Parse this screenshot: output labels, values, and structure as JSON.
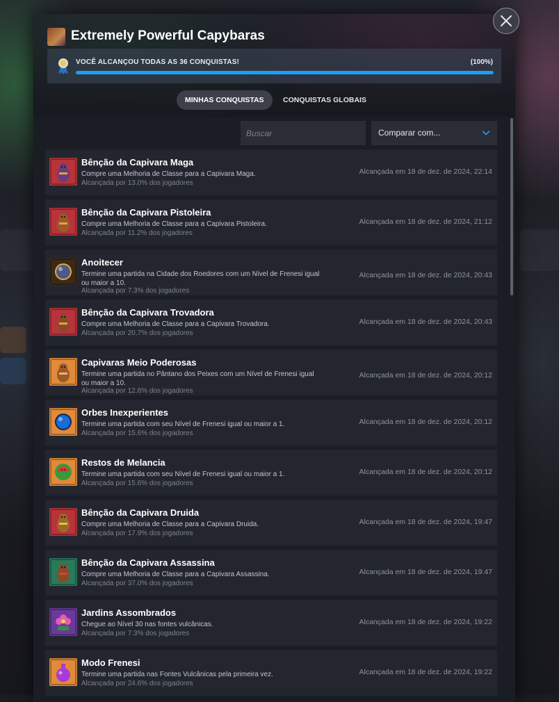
{
  "game": {
    "title": "Extremely Powerful Capybaras"
  },
  "progress": {
    "label": "VOCÊ ALCANÇOU TODAS AS 36 CONQUISTAS!",
    "percent_label": "(100%)",
    "fraction": 1.0,
    "color": "#1a9fff"
  },
  "tabs": [
    {
      "label": "MINHAS CONQUISTAS",
      "active": true
    },
    {
      "label": "CONQUISTAS GLOBAIS",
      "active": false
    }
  ],
  "search": {
    "placeholder": "Buscar"
  },
  "compare": {
    "label": "Comparar com..."
  },
  "achievements": [
    {
      "title": "Bênção da Capivara Maga",
      "desc": "Compre uma Melhoria de Classe para a Capivara Maga.",
      "pct": "Alcançada por 13.0% dos jogadores",
      "date": "Alcançada em 18 de dez. de 2024, 22:14",
      "icon": "mage-capybara-icon"
    },
    {
      "title": "Bênção da Capivara Pistoleira",
      "desc": "Compre uma Melhoria de Classe para a Capivara Pistoleira.",
      "pct": "Alcançada por 11.2% dos jogadores",
      "date": "Alcançada em 18 de dez. de 2024, 21:12",
      "icon": "gunslinger-capybara-icon"
    },
    {
      "title": "Anoitecer",
      "desc": "Termine uma partida na Cidade dos Roedores com um Nível de Frenesi igual ou maior a 10.",
      "pct": "Alcançada por 7.3% dos jogadores",
      "date": "Alcançada em 18 de dez. de 2024, 20:43",
      "icon": "night-orb-icon"
    },
    {
      "title": "Bênção da Capivara Trovadora",
      "desc": "Compre uma Melhoria de Classe para a Capivara Trovadora.",
      "pct": "Alcançada por 20.7% dos jogadores",
      "date": "Alcançada em 18 de dez. de 2024, 20:43",
      "icon": "bard-capybara-icon"
    },
    {
      "title": "Capivaras Meio Poderosas",
      "desc": "Termine uma partida no Pântano dos Peixes com um Nível de Frenesi igual ou maior a 10.",
      "pct": "Alcançada por 12.6% dos jogadores",
      "date": "Alcançada em 18 de dez. de 2024, 20:12",
      "icon": "capybara-icon"
    },
    {
      "title": "Orbes Inexperientes",
      "desc": "Termine uma partida com seu Nível de Frenesi igual ou maior a 1.",
      "pct": "Alcançada por 15.6% dos jogadores",
      "date": "Alcançada em 18 de dez. de 2024, 20:12",
      "icon": "blue-orb-icon"
    },
    {
      "title": "Restos de Melancia",
      "desc": "Termine uma partida com seu Nível de Frenesi igual ou maior a 1.",
      "pct": "Alcançada por 15.6% dos jogadores",
      "date": "Alcançada em 18 de dez. de 2024, 20:12",
      "icon": "watermelon-icon"
    },
    {
      "title": "Bênção da Capivara Druida",
      "desc": "Compre uma Melhoria de Classe para a Capivara Druida.",
      "pct": "Alcançada por 17.9% dos jogadores",
      "date": "Alcançada em 18 de dez. de 2024, 19:47",
      "icon": "druid-capybara-icon"
    },
    {
      "title": "Bênção da Capivara Assassina",
      "desc": "Compre uma Melhoria de Classe para a Capivara Assassina.",
      "pct": "Alcançada por 37.0% dos jogadores",
      "date": "Alcançada em 18 de dez. de 2024, 19:47",
      "icon": "assassin-capybara-icon"
    },
    {
      "title": "Jardins Assombrados",
      "desc": "Chegue ao Nível 30 nas fontes vulcânicas.",
      "pct": "Alcançada por 7.3% dos jogadores",
      "date": "Alcançada em 18 de dez. de 2024, 19:22",
      "icon": "haunted-flower-icon"
    },
    {
      "title": "Modo Frenesi",
      "desc": "Termine uma partida nas Fontes Vulcânicas pela primeira vez.",
      "pct": "Alcançada por 24.6% dos jogadores",
      "date": "Alcançada em 18 de dez. de 2024, 19:22",
      "icon": "purple-flask-icon"
    }
  ]
}
